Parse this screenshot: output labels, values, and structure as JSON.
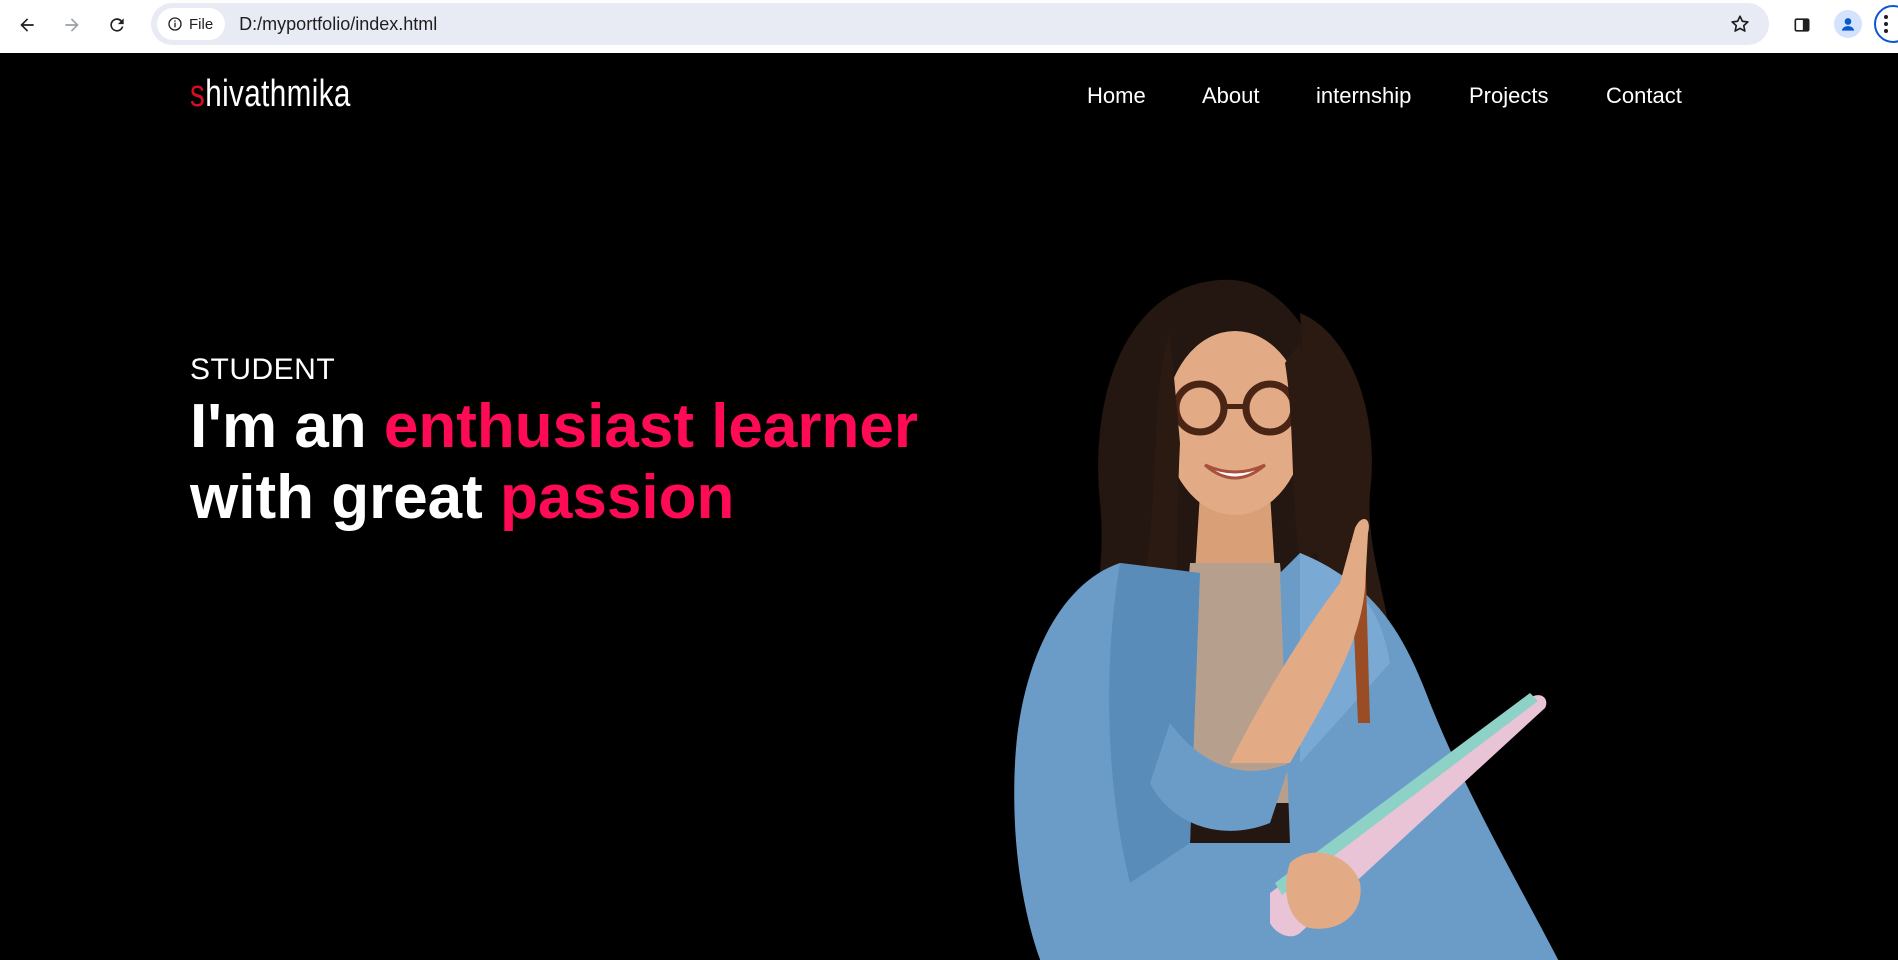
{
  "browser": {
    "chip_label": "File",
    "url": "D:/myportfolio/index.html",
    "icons": [
      "back-arrow-icon",
      "forward-arrow-icon",
      "reload-icon",
      "info-icon",
      "star-icon",
      "side-panel-icon",
      "profile-icon",
      "more-menu-icon"
    ]
  },
  "logo": {
    "first_letter": "s",
    "rest": "hivathmika",
    "accent_color": "#d10f1f"
  },
  "nav": {
    "items": [
      {
        "label": "Home"
      },
      {
        "label": "About"
      },
      {
        "label": "internship"
      },
      {
        "label": "Projects"
      },
      {
        "label": "Contact"
      }
    ]
  },
  "hero": {
    "subtitle": "STUDENT",
    "line1_plain": "I'm an ",
    "line1_accent": "enthusiast learner",
    "line2_plain": "with great ",
    "line2_accent": "passion",
    "accent_color": "#ff0a54"
  },
  "colors": {
    "page_background": "#000000",
    "text": "#ffffff",
    "omnibox": "#e8ebf4"
  }
}
